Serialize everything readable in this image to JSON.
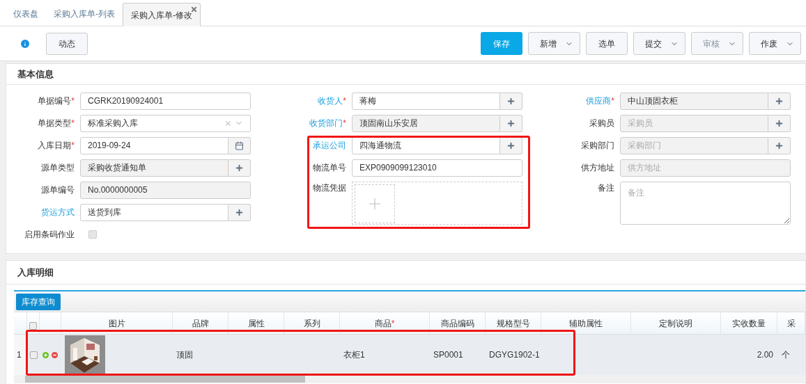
{
  "tabs": [
    {
      "label": "仪表盘",
      "selected": false
    },
    {
      "label": "采购入库单-列表",
      "selected": false
    },
    {
      "label": "采购入库单-修改",
      "selected": true
    }
  ],
  "toolbar": {
    "log_button": "动态",
    "buttons": [
      {
        "label": "保存",
        "kind": "primary",
        "disabled": false
      },
      {
        "label": "新增",
        "kind": "dropdown",
        "disabled": false
      },
      {
        "label": "选单",
        "kind": "plain",
        "disabled": false
      },
      {
        "label": "提交",
        "kind": "dropdown",
        "disabled": false
      },
      {
        "label": "审核",
        "kind": "dropdown",
        "disabled": true
      },
      {
        "label": "作废",
        "kind": "dropdown",
        "disabled": false
      }
    ]
  },
  "basic_info": {
    "title": "基本信息",
    "columns": [
      [
        {
          "label": "单据编号",
          "required_mark": "*",
          "link": false,
          "kind": "input",
          "value": "CGRK20190924001",
          "readonly": false
        },
        {
          "label": "单据类型",
          "required_mark": "*",
          "link": false,
          "kind": "select",
          "value": "标准采购入库",
          "readonly": false
        },
        {
          "label": "入库日期",
          "required_mark": "*",
          "link": false,
          "kind": "date",
          "value": "2019-09-24",
          "readonly": false
        },
        {
          "label": "源单类型",
          "link": false,
          "kind": "lookup",
          "value": "采购收货通知单",
          "readonly": true
        },
        {
          "label": "源单编号",
          "link": false,
          "kind": "input",
          "value": "No.0000000005",
          "readonly": true
        },
        {
          "label": "货运方式",
          "link": true,
          "kind": "lookup",
          "value": "送货到库",
          "readonly": false
        },
        {
          "label": "启用条码作业",
          "link": false,
          "kind": "checkbox",
          "checked": false
        }
      ],
      [
        {
          "label": "收货人",
          "required_mark": "*",
          "link": true,
          "kind": "lookup",
          "value": "蒋梅",
          "readonly": false
        },
        {
          "label": "收货部门",
          "required_mark": "*",
          "link": true,
          "kind": "lookup",
          "value": "顶固南山乐安居",
          "readonly": true
        },
        {
          "label": "承运公司",
          "link": true,
          "kind": "lookup",
          "value": "四海通物流",
          "readonly": false
        },
        {
          "label": "物流单号",
          "link": false,
          "kind": "input",
          "value": "EXP0909099123010",
          "readonly": false
        },
        {
          "label": "物流凭据",
          "link": false,
          "kind": "upload"
        }
      ],
      [
        {
          "label": "供应商",
          "required_mark": "*",
          "link": true,
          "kind": "lookup",
          "value": "中山顶固衣柜",
          "readonly": true
        },
        {
          "label": "采购员",
          "link": false,
          "kind": "lookup",
          "placeholder": "采购员",
          "readonly": true
        },
        {
          "label": "采购部门",
          "link": false,
          "kind": "lookup",
          "placeholder": "采购部门",
          "readonly": true
        },
        {
          "label": "供方地址",
          "link": false,
          "kind": "input",
          "placeholder": "供方地址",
          "readonly": true
        },
        {
          "label": "备注",
          "link": false,
          "kind": "textarea",
          "placeholder": "备注"
        }
      ]
    ]
  },
  "detail": {
    "title": "入库明细",
    "query_button": "库存查询",
    "all_checked": false,
    "columns": [
      {
        "label": "图片"
      },
      {
        "label": "品牌"
      },
      {
        "label": "属性"
      },
      {
        "label": "系列"
      },
      {
        "label": "商品",
        "required_mark": "*"
      },
      {
        "label": "商品编码"
      },
      {
        "label": "规格型号"
      },
      {
        "label": "辅助属性"
      },
      {
        "label": "定制说明"
      },
      {
        "label": "实收数量"
      },
      {
        "label": "采"
      }
    ],
    "rows": [
      {
        "number": "1",
        "checked": false,
        "brand": "顶固",
        "product": "衣柜1",
        "product_code": "SP0001",
        "spec": "DGYG1902-1",
        "quantity": "2.00",
        "unit": "个"
      }
    ]
  }
}
